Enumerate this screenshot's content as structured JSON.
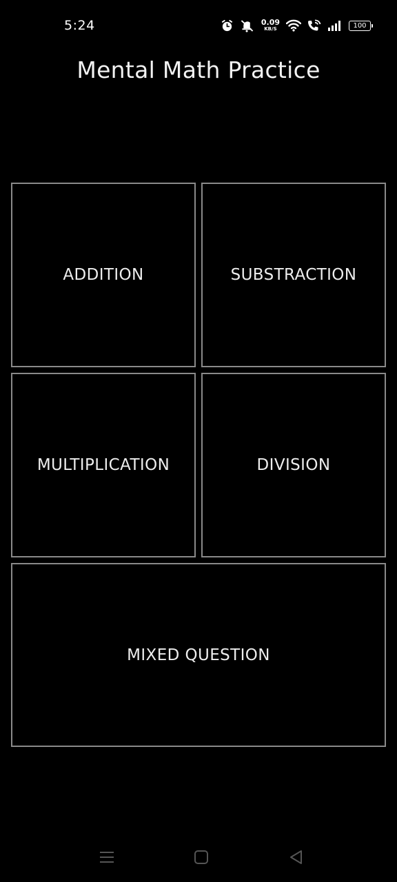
{
  "status_bar": {
    "time": "5:24",
    "net_speed_value": "0.09",
    "net_speed_unit": "KB/S",
    "battery_level": "100",
    "icons": [
      "alarm-icon",
      "mute-icon",
      "wifi-icon",
      "wifi-call-icon",
      "signal-icon",
      "battery-icon"
    ]
  },
  "app": {
    "title": "Mental Math Practice"
  },
  "tiles": {
    "addition": "ADDITION",
    "subtraction": "SUBSTRACTION",
    "multiplication": "MULTIPLICATION",
    "division": "DIVISION",
    "mixed": "MIXED QUESTION"
  },
  "nav_bar": {
    "icons": [
      "menu-icon",
      "home-icon",
      "back-icon"
    ]
  },
  "colors": {
    "background": "#000000",
    "tile_border": "#8a8a8a",
    "text": "#ededed"
  }
}
